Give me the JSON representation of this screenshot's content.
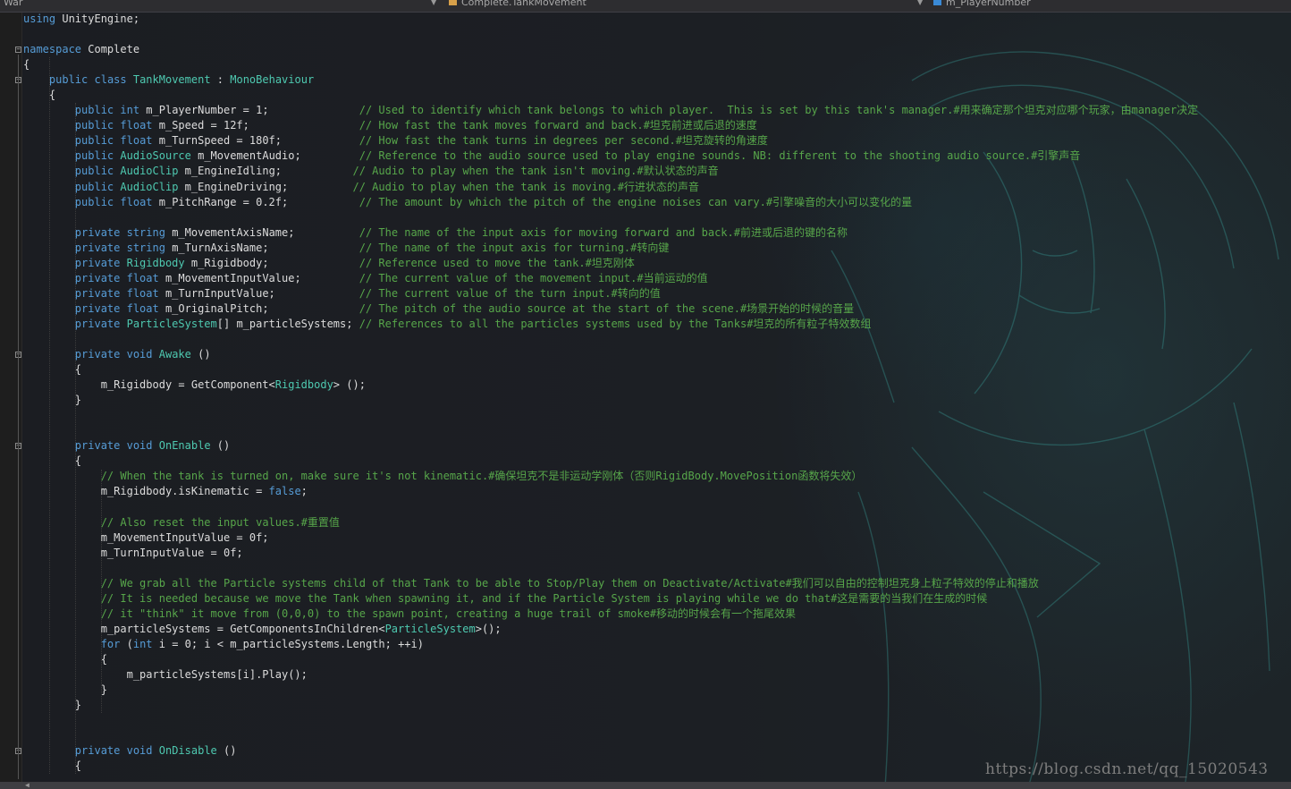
{
  "navbar": {
    "project": "War",
    "type_scope": "Complete.TankMovement",
    "member_scope": "m_PlayerNumber"
  },
  "editor": {
    "lines": [
      {
        "tokens": [
          [
            "kw",
            "using"
          ],
          [
            "pl",
            " UnityEngine;"
          ]
        ]
      },
      {
        "tokens": []
      },
      {
        "tokens": [
          [
            "kw",
            "namespace"
          ],
          [
            "pl",
            " Complete"
          ]
        ]
      },
      {
        "tokens": [
          [
            "pl",
            "{"
          ]
        ]
      },
      {
        "tokens": [
          [
            "pl",
            "    "
          ],
          [
            "kw",
            "public"
          ],
          [
            "pl",
            " "
          ],
          [
            "kw",
            "class"
          ],
          [
            "pl",
            " "
          ],
          [
            "ty",
            "TankMovement"
          ],
          [
            "pl",
            " : "
          ],
          [
            "ty",
            "MonoBehaviour"
          ]
        ]
      },
      {
        "tokens": [
          [
            "pl",
            "    {"
          ]
        ]
      },
      {
        "tokens": [
          [
            "pl",
            "        "
          ],
          [
            "kw",
            "public"
          ],
          [
            "pl",
            " "
          ],
          [
            "kw",
            "int"
          ],
          [
            "pl",
            " m_PlayerNumber = 1;              "
          ],
          [
            "cm",
            "// Used to identify which tank belongs to which player.  This is set by this tank's manager.#用来确定那个坦克对应哪个玩家，由manager决定"
          ]
        ]
      },
      {
        "tokens": [
          [
            "pl",
            "        "
          ],
          [
            "kw",
            "public"
          ],
          [
            "pl",
            " "
          ],
          [
            "kw",
            "float"
          ],
          [
            "pl",
            " m_Speed = 12f;                 "
          ],
          [
            "cm",
            "// How fast the tank moves forward and back.#坦克前进或后退的速度"
          ]
        ]
      },
      {
        "tokens": [
          [
            "pl",
            "        "
          ],
          [
            "kw",
            "public"
          ],
          [
            "pl",
            " "
          ],
          [
            "kw",
            "float"
          ],
          [
            "pl",
            " m_TurnSpeed = 180f;            "
          ],
          [
            "cm",
            "// How fast the tank turns in degrees per second.#坦克旋转的角速度"
          ]
        ]
      },
      {
        "tokens": [
          [
            "pl",
            "        "
          ],
          [
            "kw",
            "public"
          ],
          [
            "pl",
            " "
          ],
          [
            "ty",
            "AudioSource"
          ],
          [
            "pl",
            " m_MovementAudio;         "
          ],
          [
            "cm",
            "// Reference to the audio source used to play engine sounds. NB: different to the shooting audio source.#引擎声音"
          ]
        ]
      },
      {
        "tokens": [
          [
            "pl",
            "        "
          ],
          [
            "kw",
            "public"
          ],
          [
            "pl",
            " "
          ],
          [
            "ty",
            "AudioClip"
          ],
          [
            "pl",
            " m_EngineIdling;           "
          ],
          [
            "cm",
            "// Audio to play when the tank isn't moving.#默认状态的声音"
          ]
        ]
      },
      {
        "tokens": [
          [
            "pl",
            "        "
          ],
          [
            "kw",
            "public"
          ],
          [
            "pl",
            " "
          ],
          [
            "ty",
            "AudioClip"
          ],
          [
            "pl",
            " m_EngineDriving;          "
          ],
          [
            "cm",
            "// Audio to play when the tank is moving.#行进状态的声音"
          ]
        ]
      },
      {
        "tokens": [
          [
            "pl",
            "        "
          ],
          [
            "kw",
            "public"
          ],
          [
            "pl",
            " "
          ],
          [
            "kw",
            "float"
          ],
          [
            "pl",
            " m_PitchRange = 0.2f;           "
          ],
          [
            "cm",
            "// The amount by which the pitch of the engine noises can vary.#引擎噪音的大小可以变化的量"
          ]
        ]
      },
      {
        "tokens": []
      },
      {
        "tokens": [
          [
            "pl",
            "        "
          ],
          [
            "kw",
            "private"
          ],
          [
            "pl",
            " "
          ],
          [
            "kw",
            "string"
          ],
          [
            "pl",
            " m_MovementAxisName;          "
          ],
          [
            "cm",
            "// The name of the input axis for moving forward and back.#前进或后退的键的名称"
          ]
        ]
      },
      {
        "tokens": [
          [
            "pl",
            "        "
          ],
          [
            "kw",
            "private"
          ],
          [
            "pl",
            " "
          ],
          [
            "kw",
            "string"
          ],
          [
            "pl",
            " m_TurnAxisName;              "
          ],
          [
            "cm",
            "// The name of the input axis for turning.#转向键"
          ]
        ]
      },
      {
        "tokens": [
          [
            "pl",
            "        "
          ],
          [
            "kw",
            "private"
          ],
          [
            "pl",
            " "
          ],
          [
            "ty",
            "Rigidbody"
          ],
          [
            "pl",
            " m_Rigidbody;              "
          ],
          [
            "cm",
            "// Reference used to move the tank.#坦克刚体"
          ]
        ]
      },
      {
        "tokens": [
          [
            "pl",
            "        "
          ],
          [
            "kw",
            "private"
          ],
          [
            "pl",
            " "
          ],
          [
            "kw",
            "float"
          ],
          [
            "pl",
            " m_MovementInputValue;         "
          ],
          [
            "cm",
            "// The current value of the movement input.#当前运动的值"
          ]
        ]
      },
      {
        "tokens": [
          [
            "pl",
            "        "
          ],
          [
            "kw",
            "private"
          ],
          [
            "pl",
            " "
          ],
          [
            "kw",
            "float"
          ],
          [
            "pl",
            " m_TurnInputValue;             "
          ],
          [
            "cm",
            "// The current value of the turn input.#转向的值"
          ]
        ]
      },
      {
        "tokens": [
          [
            "pl",
            "        "
          ],
          [
            "kw",
            "private"
          ],
          [
            "pl",
            " "
          ],
          [
            "kw",
            "float"
          ],
          [
            "pl",
            " m_OriginalPitch;              "
          ],
          [
            "cm",
            "// The pitch of the audio source at the start of the scene.#场景开始的时候的音量"
          ]
        ]
      },
      {
        "tokens": [
          [
            "pl",
            "        "
          ],
          [
            "kw",
            "private"
          ],
          [
            "pl",
            " "
          ],
          [
            "ty",
            "ParticleSystem"
          ],
          [
            "pl",
            "[] m_particleSystems; "
          ],
          [
            "cm",
            "// References to all the particles systems used by the Tanks#坦克的所有粒子特效数组"
          ]
        ]
      },
      {
        "tokens": []
      },
      {
        "tokens": [
          [
            "pl",
            "        "
          ],
          [
            "kw",
            "private"
          ],
          [
            "pl",
            " "
          ],
          [
            "kw",
            "void"
          ],
          [
            "pl",
            " "
          ],
          [
            "ty",
            "Awake"
          ],
          [
            "pl",
            " ()"
          ]
        ]
      },
      {
        "tokens": [
          [
            "pl",
            "        {"
          ]
        ]
      },
      {
        "tokens": [
          [
            "pl",
            "            m_Rigidbody = GetComponent<"
          ],
          [
            "ty",
            "Rigidbody"
          ],
          [
            "pl",
            "> ();"
          ]
        ]
      },
      {
        "tokens": [
          [
            "pl",
            "        }"
          ]
        ]
      },
      {
        "tokens": []
      },
      {
        "tokens": []
      },
      {
        "tokens": [
          [
            "pl",
            "        "
          ],
          [
            "kw",
            "private"
          ],
          [
            "pl",
            " "
          ],
          [
            "kw",
            "void"
          ],
          [
            "pl",
            " "
          ],
          [
            "ty",
            "OnEnable"
          ],
          [
            "pl",
            " ()"
          ]
        ]
      },
      {
        "tokens": [
          [
            "pl",
            "        {"
          ]
        ]
      },
      {
        "tokens": [
          [
            "pl",
            "            "
          ],
          [
            "cm",
            "// When the tank is turned on, make sure it's not kinematic.#确保坦克不是非运动学刚体（否则RigidBody.MovePosition函数将失效）"
          ]
        ]
      },
      {
        "tokens": [
          [
            "pl",
            "            m_Rigidbody.isKinematic = "
          ],
          [
            "kw",
            "false"
          ],
          [
            "pl",
            ";"
          ]
        ]
      },
      {
        "tokens": []
      },
      {
        "tokens": [
          [
            "pl",
            "            "
          ],
          [
            "cm",
            "// Also reset the input values.#重置值"
          ]
        ]
      },
      {
        "tokens": [
          [
            "pl",
            "            m_MovementInputValue = 0f;"
          ]
        ]
      },
      {
        "tokens": [
          [
            "pl",
            "            m_TurnInputValue = 0f;"
          ]
        ]
      },
      {
        "tokens": []
      },
      {
        "tokens": [
          [
            "pl",
            "            "
          ],
          [
            "cm",
            "// We grab all the Particle systems child of that Tank to be able to Stop/Play them on Deactivate/Activate#我们可以自由的控制坦克身上粒子特效的停止和播放"
          ]
        ]
      },
      {
        "tokens": [
          [
            "pl",
            "            "
          ],
          [
            "cm",
            "// It is needed because we move the Tank when spawning it, and if the Particle System is playing while we do that#这是需要的当我们在生成的时候"
          ]
        ]
      },
      {
        "tokens": [
          [
            "pl",
            "            "
          ],
          [
            "cm",
            "// it \"think\" it move from (0,0,0) to the spawn point, creating a huge trail of smoke#移动的时候会有一个拖尾效果"
          ]
        ]
      },
      {
        "tokens": [
          [
            "pl",
            "            m_particleSystems = GetComponentsInChildren<"
          ],
          [
            "ty",
            "ParticleSystem"
          ],
          [
            "pl",
            ">();"
          ]
        ]
      },
      {
        "tokens": [
          [
            "pl",
            "            "
          ],
          [
            "kw",
            "for"
          ],
          [
            "pl",
            " ("
          ],
          [
            "kw",
            "int"
          ],
          [
            "pl",
            " i = 0; i < m_particleSystems.Length; ++i)"
          ]
        ]
      },
      {
        "tokens": [
          [
            "pl",
            "            {"
          ]
        ]
      },
      {
        "tokens": [
          [
            "pl",
            "                m_particleSystems[i].Play();"
          ]
        ]
      },
      {
        "tokens": [
          [
            "pl",
            "            }"
          ]
        ]
      },
      {
        "tokens": [
          [
            "pl",
            "        }"
          ]
        ]
      },
      {
        "tokens": []
      },
      {
        "tokens": []
      },
      {
        "tokens": [
          [
            "pl",
            "        "
          ],
          [
            "kw",
            "private"
          ],
          [
            "pl",
            " "
          ],
          [
            "kw",
            "void"
          ],
          [
            "pl",
            " "
          ],
          [
            "ty",
            "OnDisable"
          ],
          [
            "pl",
            " ()"
          ]
        ]
      },
      {
        "tokens": [
          [
            "pl",
            "        {"
          ]
        ]
      }
    ]
  },
  "folds": [
    "namespace",
    "class",
    "Awake",
    "OnEnable",
    "OnDisable"
  ],
  "watermark": "https://blog.csdn.net/qq_15020543",
  "colors": {
    "keyword": "#569cd6",
    "type": "#4ec9b0",
    "comment": "#57a64a",
    "plain": "#dcdcdc"
  }
}
